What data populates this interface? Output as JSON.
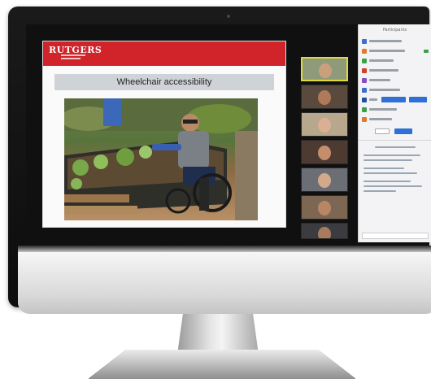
{
  "slide": {
    "logo": "RUTGERS",
    "logo_subtitle": "",
    "title": "Wheelchair accessibility"
  },
  "panel": {
    "title": "Participants"
  },
  "colors": {
    "brand_red": "#d0232a",
    "panel_bg": "#f3f3f5",
    "active_tile_border": "#e1d83a",
    "button_blue": "#2f6fd6"
  },
  "participants": [
    "tile",
    "tile",
    "tile",
    "tile",
    "tile",
    "tile",
    "tile"
  ],
  "icons": [
    "camera-dot"
  ]
}
